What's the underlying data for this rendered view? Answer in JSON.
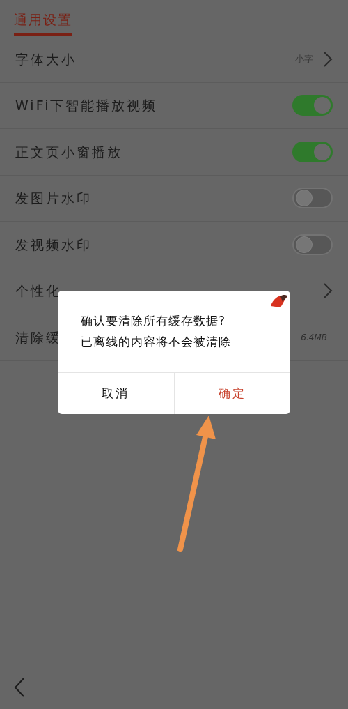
{
  "header": {
    "title": "通用设置",
    "selected": true
  },
  "settings": [
    {
      "kind": "link",
      "label": "字体大小",
      "value": "小字"
    },
    {
      "kind": "toggle",
      "label": "WiFi下智能播放视频",
      "on": true
    },
    {
      "kind": "toggle",
      "label": "正文页小窗播放",
      "on": true
    },
    {
      "kind": "toggle",
      "label": "发图片水印",
      "on": false
    },
    {
      "kind": "toggle",
      "label": "发视频水印",
      "on": false
    },
    {
      "kind": "link",
      "label": "个性化"
    },
    {
      "kind": "value",
      "label": "清除缓",
      "value": "6.4MB"
    }
  ],
  "dialog": {
    "lines": [
      "确认要清除所有缓存数据?",
      "已离线的内容将不会被清除"
    ],
    "buttons": [
      {
        "kind": "cancel",
        "label": "取消"
      },
      {
        "kind": "confirm",
        "label": "确定"
      }
    ]
  }
}
